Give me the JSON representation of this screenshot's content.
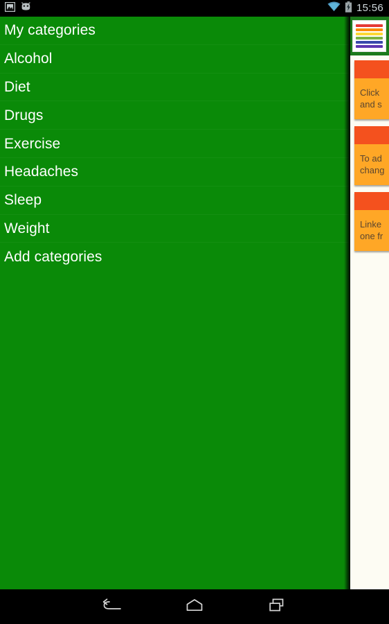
{
  "status_bar": {
    "left_icons": [
      {
        "name": "screenshot-image-icon",
        "label": "screenshot"
      },
      {
        "name": "android-robot-face-icon",
        "label": "android"
      }
    ],
    "right_icons": [
      {
        "name": "wifi-icon",
        "label": "wifi"
      },
      {
        "name": "battery-charging-icon",
        "label": "battery charging"
      }
    ],
    "clock": "15:56"
  },
  "drawer": {
    "title": "My categories",
    "items": [
      {
        "label": "My categories",
        "is_header": true
      },
      {
        "label": "Alcohol",
        "is_header": false
      },
      {
        "label": "Diet",
        "is_header": false
      },
      {
        "label": "Drugs",
        "is_header": false
      },
      {
        "label": "Exercise",
        "is_header": false
      },
      {
        "label": "Headaches",
        "is_header": false
      },
      {
        "label": "Sleep",
        "is_header": false
      },
      {
        "label": "Weight",
        "is_header": false
      },
      {
        "label": "Add categories",
        "is_header": false
      }
    ],
    "background_color": "#0a8a08",
    "text_color": "#ffffff"
  },
  "content_pane": {
    "app_icon": {
      "name": "colored-stripes-list-icon",
      "stripe_colors": [
        "#e53935",
        "#fb8c00",
        "#fdd835",
        "#7cb342",
        "#3949ab",
        "#5e35b1"
      ]
    },
    "header_background": "#1b7a1b",
    "background_color": "#fdfcf3",
    "cards": [
      {
        "band_color": "#f4511e",
        "body_color": "#ffa726",
        "text": "Click\nand s"
      },
      {
        "band_color": "#f4511e",
        "body_color": "#ffa726",
        "text": "To ad\nchang"
      },
      {
        "band_color": "#f4511e",
        "body_color": "#ffa726",
        "text": "Linke\none fr"
      }
    ]
  },
  "nav_bar": {
    "buttons": [
      {
        "name": "back-icon",
        "label": "Back"
      },
      {
        "name": "home-icon",
        "label": "Home"
      },
      {
        "name": "recents-icon",
        "label": "Recent apps"
      }
    ],
    "background_color": "#000000"
  }
}
